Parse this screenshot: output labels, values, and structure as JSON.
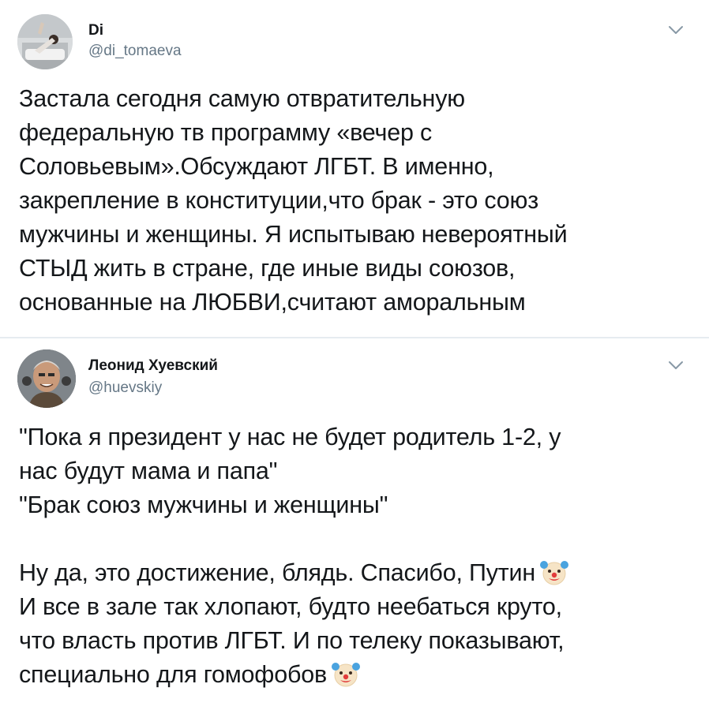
{
  "tweets": [
    {
      "author": {
        "name": "Di",
        "handle": "@di_tomaeva"
      },
      "lines": [
        "Застала сегодня самую отвратительную",
        "федеральную тв программу «вечер с",
        "Соловьевым».Обсуждают ЛГБТ. В именно,",
        "закрепление в конституции,что брак - это союз",
        "мужчины и женщины. Я испытываю невероятный",
        "СТЫД жить в стране, где иные виды союзов,",
        "основанные на ЛЮБВИ,считают аморальным"
      ]
    },
    {
      "author": {
        "name": "Леонид Хуевский",
        "handle": "@huevskiy"
      },
      "lines": [
        "\"Пока я президент у нас не будет родитель 1-2, у",
        "нас будут мама и папа\"",
        "\"Брак союз мужчины и женщины\""
      ],
      "lines2": [
        "Ну да, это достижение, блядь. Спасибо, Путин",
        "И все в зале так хлопают, будто неебаться круто,",
        "что власть против ЛГБТ. И по телеку показывают,",
        "специально для гомофобов"
      ]
    }
  ],
  "icons": {
    "menu": "chevron-down-icon",
    "emoji": "clown-face-emoji"
  },
  "colors": {
    "text": "#14171a",
    "secondary": "#657786",
    "divider": "#e6ecf0"
  }
}
